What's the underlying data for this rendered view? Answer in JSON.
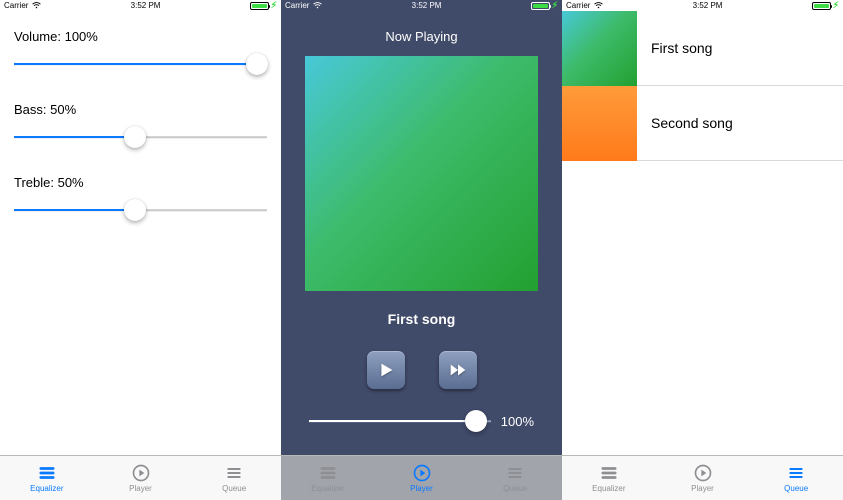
{
  "status": {
    "carrier": "Carrier",
    "time": "3:52 PM"
  },
  "tabs": {
    "equalizer": "Equalizer",
    "player": "Player",
    "queue": "Queue"
  },
  "equalizer": {
    "volume_label": "Volume: 100%",
    "volume_pct": 100,
    "bass_label": "Bass: 50%",
    "bass_pct": 50,
    "treble_label": "Treble: 50%",
    "treble_pct": 50
  },
  "player": {
    "now_playing_label": "Now Playing",
    "song_title": "First song",
    "volume_pct": 100,
    "volume_text": "100%"
  },
  "queue": {
    "items": [
      {
        "title": "First song"
      },
      {
        "title": "Second song"
      }
    ]
  }
}
